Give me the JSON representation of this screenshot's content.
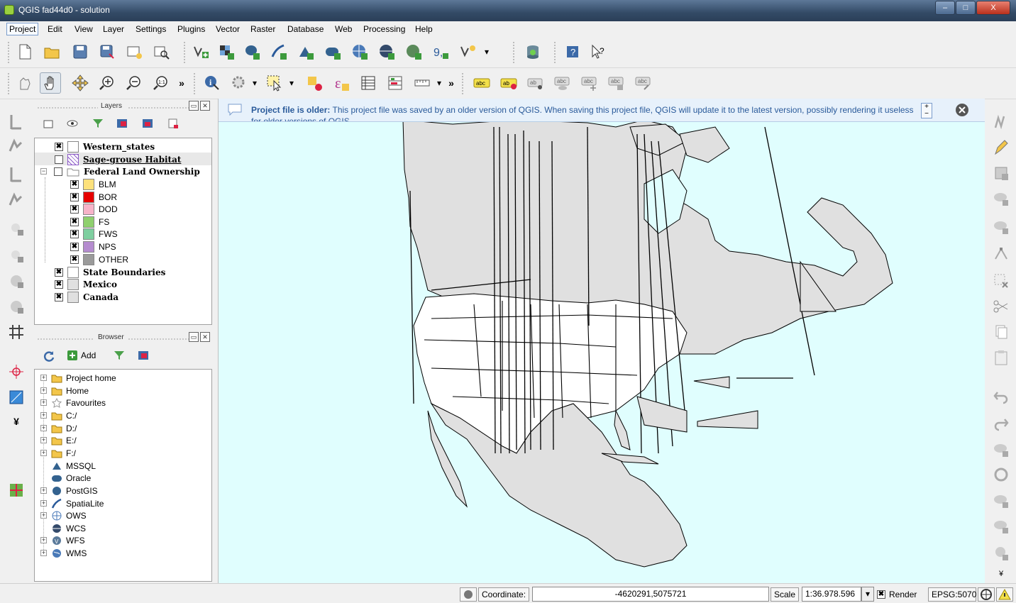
{
  "window": {
    "title": "QGIS fad44d0 - solution",
    "buttons": {
      "minimize": "–",
      "maximize": "□",
      "close": "X"
    }
  },
  "menubar": {
    "items": [
      "Project",
      "Edit",
      "View",
      "Layer",
      "Settings",
      "Plugins",
      "Vector",
      "Raster",
      "Database",
      "Web",
      "Processing",
      "Help"
    ]
  },
  "toolbar": {
    "overflow": "»",
    "dropdown": "▾"
  },
  "layers_panel": {
    "title": "Layers",
    "layers": [
      {
        "name": "Western_states",
        "checked": true,
        "bold": true,
        "color": "#ffffff"
      },
      {
        "name": "Sage-grouse Habitat",
        "checked": false,
        "bold": true,
        "color": "hatch"
      },
      {
        "name": "Federal Land Ownership",
        "checked": false,
        "bold": true,
        "group": true
      },
      {
        "name": "BLM",
        "checked": true,
        "color": "#fde17c",
        "child": true
      },
      {
        "name": "BOR",
        "checked": true,
        "color": "#e60000",
        "child": true
      },
      {
        "name": "DOD",
        "checked": true,
        "color": "#f7b3c9",
        "child": true
      },
      {
        "name": "FS",
        "checked": true,
        "color": "#8fd06e",
        "child": true
      },
      {
        "name": "FWS",
        "checked": true,
        "color": "#7fcfa0",
        "child": true
      },
      {
        "name": "NPS",
        "checked": true,
        "color": "#b58ccf",
        "child": true
      },
      {
        "name": "OTHER",
        "checked": true,
        "color": "#9a9a9a",
        "child": true
      },
      {
        "name": "State Boundaries",
        "checked": true,
        "bold": true,
        "color": "#ffffff"
      },
      {
        "name": "Mexico",
        "checked": true,
        "bold": true,
        "color": "#e0e0e0"
      },
      {
        "name": "Canada",
        "checked": true,
        "bold": true,
        "color": "#e0e0e0"
      }
    ]
  },
  "browser_panel": {
    "title": "Browser",
    "add_label": "Add",
    "items": [
      {
        "label": "Project home",
        "icon": "folder-icon",
        "expandable": true
      },
      {
        "label": "Home",
        "icon": "folder-icon",
        "expandable": true
      },
      {
        "label": "Favourites",
        "icon": "star-icon",
        "expandable": true
      },
      {
        "label": "C:/",
        "icon": "folder-icon",
        "expandable": true
      },
      {
        "label": "D:/",
        "icon": "folder-icon",
        "expandable": true
      },
      {
        "label": "E:/",
        "icon": "folder-icon",
        "expandable": true
      },
      {
        "label": "F:/",
        "icon": "folder-icon",
        "expandable": true
      },
      {
        "label": "MSSQL",
        "icon": "mssql-icon",
        "expandable": false
      },
      {
        "label": "Oracle",
        "icon": "oracle-icon",
        "expandable": false
      },
      {
        "label": "PostGIS",
        "icon": "postgis-icon",
        "expandable": true
      },
      {
        "label": "SpatiaLite",
        "icon": "spatialite-icon",
        "expandable": true
      },
      {
        "label": "OWS",
        "icon": "ows-icon",
        "expandable": true
      },
      {
        "label": "WCS",
        "icon": "wcs-icon",
        "expandable": false
      },
      {
        "label": "WFS",
        "icon": "wfs-icon",
        "expandable": true
      },
      {
        "label": "WMS",
        "icon": "wms-icon",
        "expandable": true
      }
    ]
  },
  "message_bar": {
    "title": "Project file is older:",
    "text": "This project file was saved by an older version of QGIS. When saving this project file, QGIS will update it to the latest version, possibly rendering it useless",
    "text2": "for older versions of QGIS."
  },
  "statusbar": {
    "coordinate_label": "Coordinate:",
    "coordinate_value": "-4620291,5075721",
    "scale_label": "Scale",
    "scale_value": "1:36.978.596",
    "render_label": "Render",
    "render_checked": true,
    "crs": "EPSG:5070"
  },
  "colors": {
    "map_background": "#e0fefe",
    "land": "#e0e0e0",
    "message_bar": "#e7f1fb"
  }
}
